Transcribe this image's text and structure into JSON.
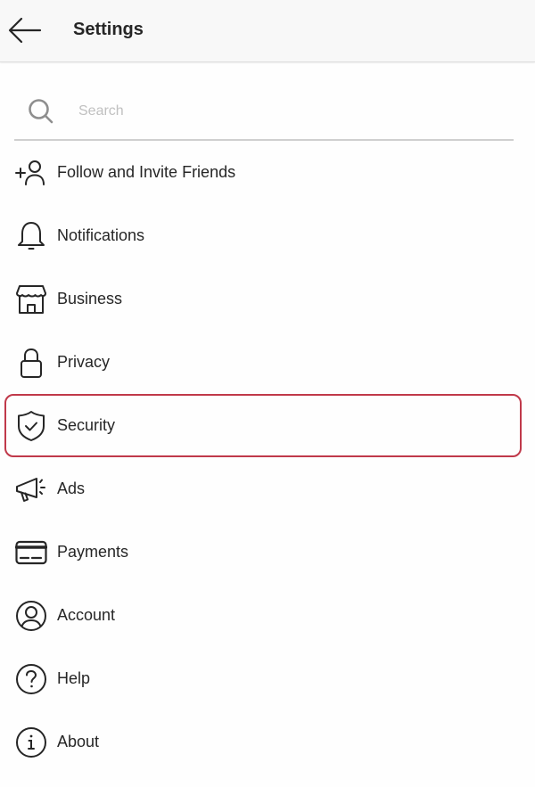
{
  "header": {
    "back_icon": "arrow-left-icon",
    "title": "Settings"
  },
  "search": {
    "icon": "search-icon",
    "placeholder": "Search",
    "value": ""
  },
  "menu": {
    "selected_index": 4,
    "highlight_color": "#c0394a",
    "items": [
      {
        "label": "Follow and Invite Friends",
        "icon": "add-person-icon"
      },
      {
        "label": "Notifications",
        "icon": "bell-icon"
      },
      {
        "label": "Business",
        "icon": "storefront-icon"
      },
      {
        "label": "Privacy",
        "icon": "lock-icon"
      },
      {
        "label": "Security",
        "icon": "shield-check-icon"
      },
      {
        "label": "Ads",
        "icon": "megaphone-icon"
      },
      {
        "label": "Payments",
        "icon": "credit-card-icon"
      },
      {
        "label": "Account",
        "icon": "account-circle-icon"
      },
      {
        "label": "Help",
        "icon": "help-circle-icon"
      },
      {
        "label": "About",
        "icon": "info-circle-icon"
      }
    ]
  }
}
